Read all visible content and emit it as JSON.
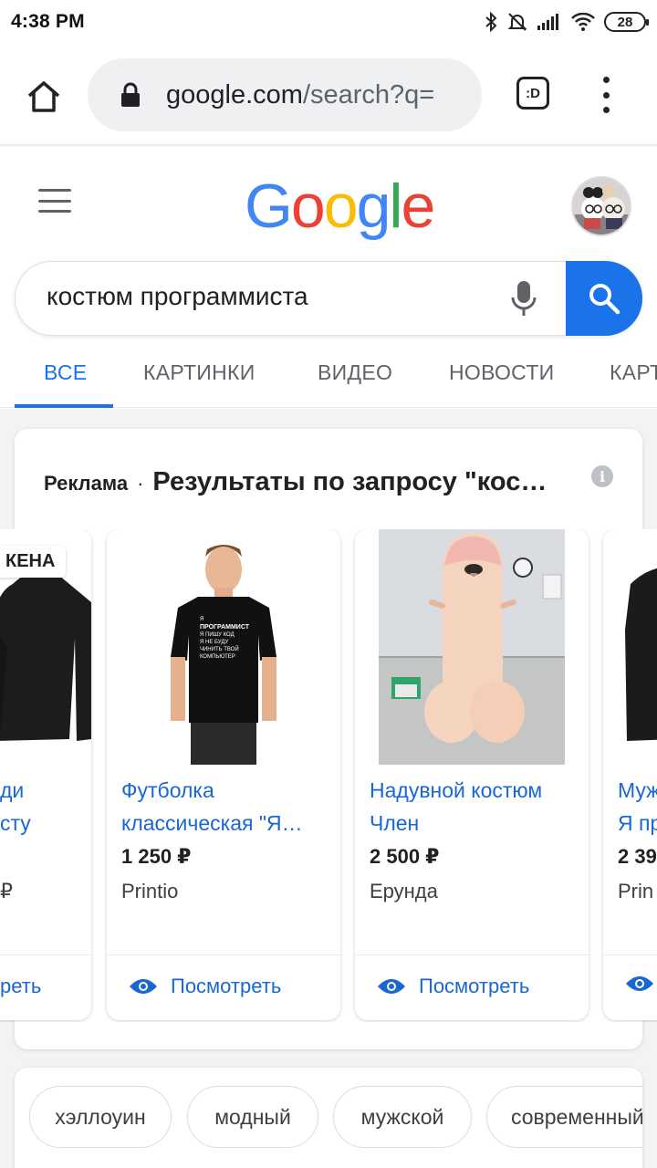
{
  "status_bar": {
    "time": "4:38 PM",
    "battery": "28"
  },
  "browser": {
    "url_domain": "google.com",
    "url_path": "/search?q=",
    "tab_label": ":D"
  },
  "google": {
    "logo_letters": [
      "G",
      "o",
      "o",
      "g",
      "l",
      "e"
    ],
    "logo_colors": [
      "#4285F4",
      "#EA4335",
      "#FBBC05",
      "#4285F4",
      "#34A853",
      "#EA4335"
    ]
  },
  "search": {
    "query": "костюм программиста"
  },
  "tabs": [
    {
      "label": "ВСЕ",
      "active": true
    },
    {
      "label": "КАРТИНКИ",
      "active": false
    },
    {
      "label": "ВИДЕО",
      "active": false
    },
    {
      "label": "НОВОСТИ",
      "active": false
    },
    {
      "label": "КАРТЫ",
      "active": false
    }
  ],
  "ads": {
    "label": "Реклама",
    "separator": "·",
    "title": "Результаты по запросу \"кос…",
    "info_icon": "i",
    "products": [
      {
        "title_line1": "ди",
        "title_line2": "сту",
        "price": "",
        "seller": "₽",
        "view_label": "реть",
        "badge": "КЕНА"
      },
      {
        "title_line1": "Футболка",
        "title_line2": "классическая \"Я…",
        "price": "1 250 ₽",
        "seller": "Printio",
        "view_label": "Посмотреть",
        "shirt_text": [
          "Я",
          "ПРОГРАММИСТ",
          "Я ПИШУ КОД",
          "Я НЕ БУДУ",
          "ЧИНИТЬ ТВОЙ",
          "КОМПЬЮТЕР"
        ]
      },
      {
        "title_line1": "Надувной костюм",
        "title_line2": "Член",
        "price": "2 500 ₽",
        "seller": "Ерунда",
        "view_label": "Посмотреть"
      },
      {
        "title_line1": "Муж",
        "title_line2": "Я пр",
        "price": "2 39",
        "seller": "Prin",
        "view_label": ""
      }
    ]
  },
  "related_chips": [
    "хэллоуин",
    "модный",
    "мужской",
    "современный"
  ]
}
